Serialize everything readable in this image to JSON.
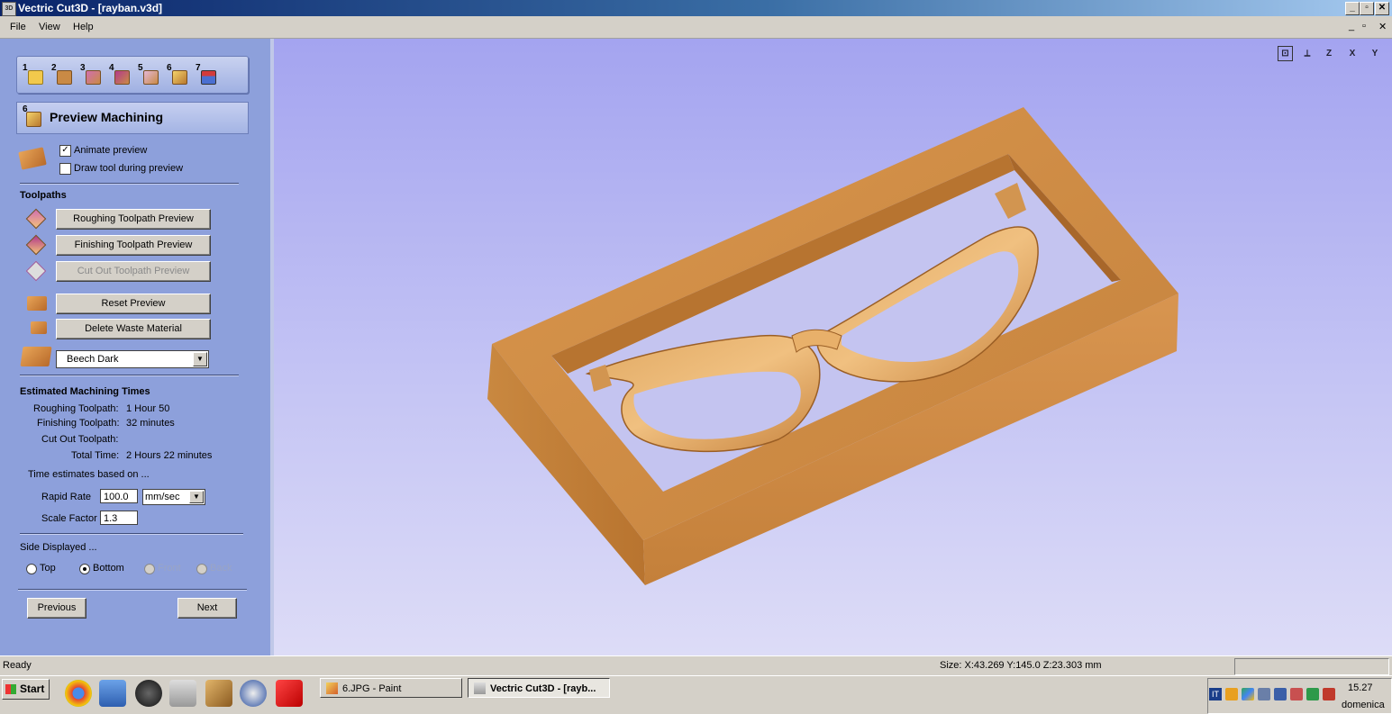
{
  "window": {
    "app_icon": "cut3d-app-icon",
    "title": "Vectric Cut3D - [rayban.v3d]",
    "controls": [
      "_",
      "▫",
      "✕"
    ]
  },
  "menu": {
    "items": [
      "File",
      "View",
      "Help"
    ],
    "mdi_controls": [
      "_",
      "▫",
      "✕"
    ]
  },
  "toolbar": {
    "steps": [
      {
        "num": "1",
        "icon": "open-folder-icon"
      },
      {
        "num": "2",
        "icon": "material-setup-icon"
      },
      {
        "num": "3",
        "icon": "roughing-icon"
      },
      {
        "num": "4",
        "icon": "finishing-icon"
      },
      {
        "num": "5",
        "icon": "cutout-icon"
      },
      {
        "num": "6",
        "icon": "preview-icon"
      },
      {
        "num": "7",
        "icon": "save-toolpath-icon"
      }
    ]
  },
  "panel": {
    "header_num": "6",
    "header": "Preview Machining",
    "animate_preview": {
      "label": "Animate preview",
      "checked": true
    },
    "draw_tool": {
      "label": "Draw tool during preview",
      "checked": false
    },
    "check_mark": "✓",
    "toolpaths_heading": "Toolpaths",
    "roughing_btn": "Roughing Toolpath Preview",
    "finishing_btn": "Finishing Toolpath Preview",
    "cutout_btn": "Cut Out Toolpath Preview",
    "reset_btn": "Reset Preview",
    "delete_waste_btn": "Delete Waste Material",
    "material": "Beech Dark",
    "dropdown_arrow": "▼",
    "times_heading": "Estimated Machining Times",
    "times": {
      "roughing_label": "Roughing Toolpath:",
      "roughing_value": "1 Hour 50",
      "finishing_label": "Finishing Toolpath:",
      "finishing_value": "32 minutes",
      "cutout_label": "Cut Out Toolpath:",
      "cutout_value": "",
      "total_label": "Total Time:",
      "total_value": "2 Hours 22 minutes"
    },
    "based_on": "Time estimates based on ...",
    "rapid_rate_label": "Rapid Rate",
    "rapid_rate_value": "100.0",
    "rapid_rate_unit": "mm/sec",
    "scale_factor_label": "Scale Factor",
    "scale_factor_value": "1.3",
    "side_heading": "Side Displayed ...",
    "sides": {
      "top": "Top",
      "bottom": "Bottom",
      "front": "Front",
      "back": "Back",
      "selected": "Bottom"
    },
    "previous_btn": "Previous",
    "next_btn": "Next"
  },
  "viewport": {
    "view_icons": [
      "zoom-extents-icon",
      "iso-view-icon",
      "z-view-icon",
      "x-view-icon",
      "y-view-icon"
    ],
    "view_labels": [
      "⊡",
      "⟂",
      "Z",
      "X",
      "Y"
    ]
  },
  "status": {
    "left": "Ready",
    "size": "Size: X:43.269 Y:145.0 Z:23.303 mm"
  },
  "taskbar": {
    "start": "Start",
    "quick_launch": [
      "chrome-icon",
      "explorer-icon",
      "media-icon",
      "cut3d-icon",
      "aspire-icon",
      "compass-icon",
      "sketchup-icon"
    ],
    "tasks": [
      {
        "label": "6.JPG - Paint",
        "active": false
      },
      {
        "label": "Vectric Cut3D - [rayb...",
        "active": true
      }
    ],
    "tray_lang": "IT",
    "clock": "15.27",
    "day": "domenica"
  },
  "colors": {
    "panel_bg": "#8da0db",
    "viewport_top": "#a4a4f0",
    "viewport_bottom": "#dddcf7",
    "wood": "#c98a45",
    "title_bar": "#0a246a"
  }
}
